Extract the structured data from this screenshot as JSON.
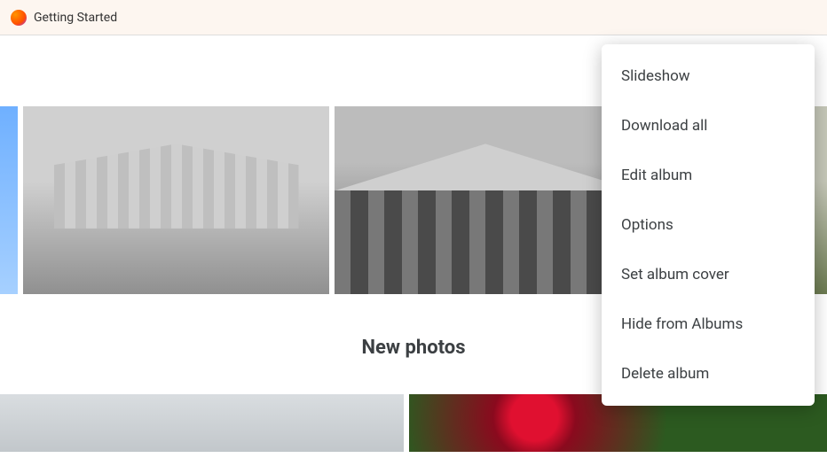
{
  "bookmarks": {
    "item1_label": "Getting Started"
  },
  "toolbar": {
    "shopping_aria": "Photo prints and more"
  },
  "menu": {
    "slideshow": "Slideshow",
    "download_all": "Download all",
    "edit_album": "Edit album",
    "options": "Options",
    "set_cover": "Set album cover",
    "hide": "Hide from Albums",
    "delete": "Delete album"
  },
  "sections": {
    "new_photos": "New photos"
  }
}
